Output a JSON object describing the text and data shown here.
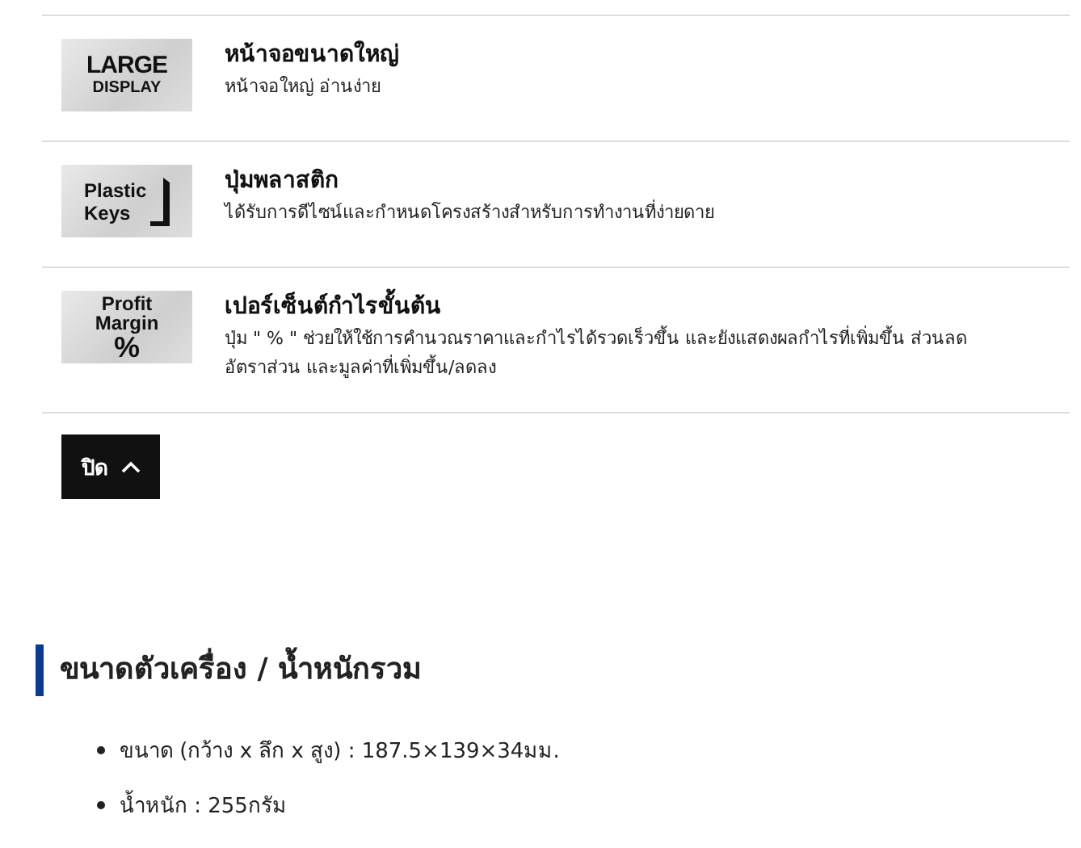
{
  "features": [
    {
      "badge": [
        "LARGE",
        "DISPLAY"
      ],
      "kind": "display",
      "title": "หน้าจอขนาดใหญ่",
      "description": "หน้าจอใหญ่ อ่านง่าย"
    },
    {
      "badge": [
        "Plastic",
        "Keys"
      ],
      "kind": "keys",
      "title": "ปุ่มพลาสติก",
      "description": "ได้รับการดีไซน์และกำหนดโครงสร้างสำหรับการทำงานที่ง่ายดาย"
    },
    {
      "badge": [
        "Profit",
        "Margin",
        "%"
      ],
      "kind": "margin",
      "title": "เปอร์เซ็นต์กำไรขั้นต้น",
      "description": "ปุ่ม \" % \" ช่วยให้ใช้การคำนวณราคาและกำไรได้รวดเร็วขึ้น และยังแสดงผลกำไรที่เพิ่มขึ้น ส่วนลด อัตราส่วน และมูลค่าที่เพิ่มขึ้น/ลดลง"
    }
  ],
  "close_button": {
    "label": "ปิด"
  },
  "section": {
    "heading": "ขนาดตัวเครื่อง / น้ำหนักรวม",
    "specs": [
      "ขนาด (กว้าง x ลึก x สูง) : 187.5×139×34มม.",
      "น้ำหนัก : 255กรัม"
    ]
  }
}
